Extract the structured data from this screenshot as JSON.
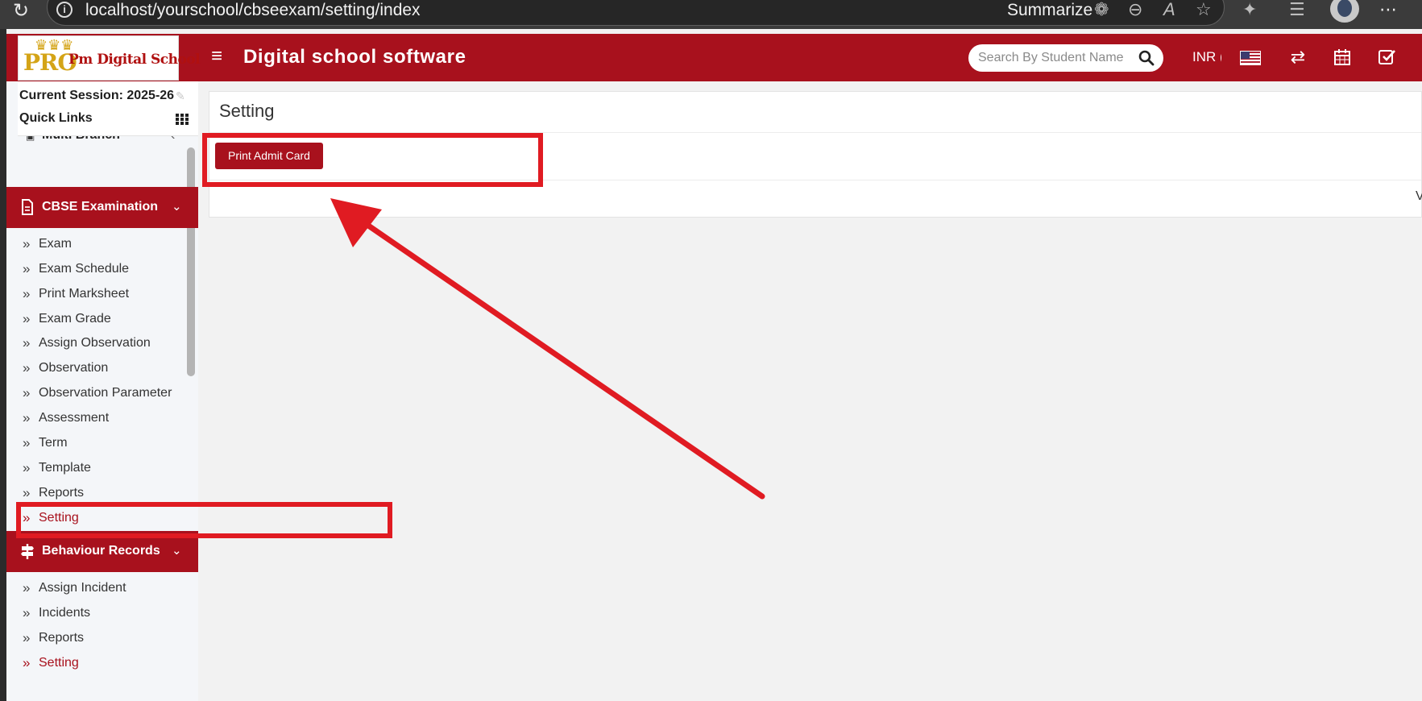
{
  "browser": {
    "url": "localhost/yourschool/cbseexam/setting/index",
    "summarize": "Summarize",
    "icons": [
      "reload-icon",
      "info-icon",
      "copilot-icon",
      "zoom-out-icon",
      "read-aloud-icon",
      "favorite-star-icon",
      "extensions-icon",
      "favorites-list-icon",
      "profile-avatar",
      "more-icon"
    ]
  },
  "header": {
    "logo_pro": "PRO",
    "logo_name": "Pm Digital School",
    "app_title": "Digital school software",
    "search_placeholder": "Search By Student Name",
    "currency": "INR (",
    "icons": [
      "menu-icon",
      "search-icon",
      "us-flag-icon",
      "switch-icon",
      "calendar-icon",
      "task-check-icon"
    ]
  },
  "sidebar": {
    "session": "Current Session: 2025-26",
    "quick_links": "Quick Links",
    "partial_item": "Multi Branch",
    "sections": [
      {
        "label": "CBSE Examination",
        "icon": "document-icon",
        "items": [
          {
            "label": "Exam",
            "active": false
          },
          {
            "label": "Exam Schedule",
            "active": false
          },
          {
            "label": "Print Marksheet",
            "active": false
          },
          {
            "label": "Exam Grade",
            "active": false
          },
          {
            "label": "Assign Observation",
            "active": false
          },
          {
            "label": "Observation",
            "active": false
          },
          {
            "label": "Observation Parameter",
            "active": false
          },
          {
            "label": "Assessment",
            "active": false
          },
          {
            "label": "Term",
            "active": false
          },
          {
            "label": "Template",
            "active": false
          },
          {
            "label": "Reports",
            "active": false
          },
          {
            "label": "Setting",
            "active": true
          }
        ]
      },
      {
        "label": "Behaviour Records",
        "icon": "signpost-icon",
        "items": [
          {
            "label": "Assign Incident",
            "active": false
          },
          {
            "label": "Incidents",
            "active": false
          },
          {
            "label": "Reports",
            "active": false
          },
          {
            "label": "Setting",
            "active": true
          }
        ]
      }
    ]
  },
  "main": {
    "title": "Setting",
    "print_button": "Print Admit Card",
    "cut_text": "Ve"
  },
  "colors": {
    "brand": "#a8111d",
    "annotation": "#e01b22",
    "page_bg": "#f2f2f2"
  }
}
